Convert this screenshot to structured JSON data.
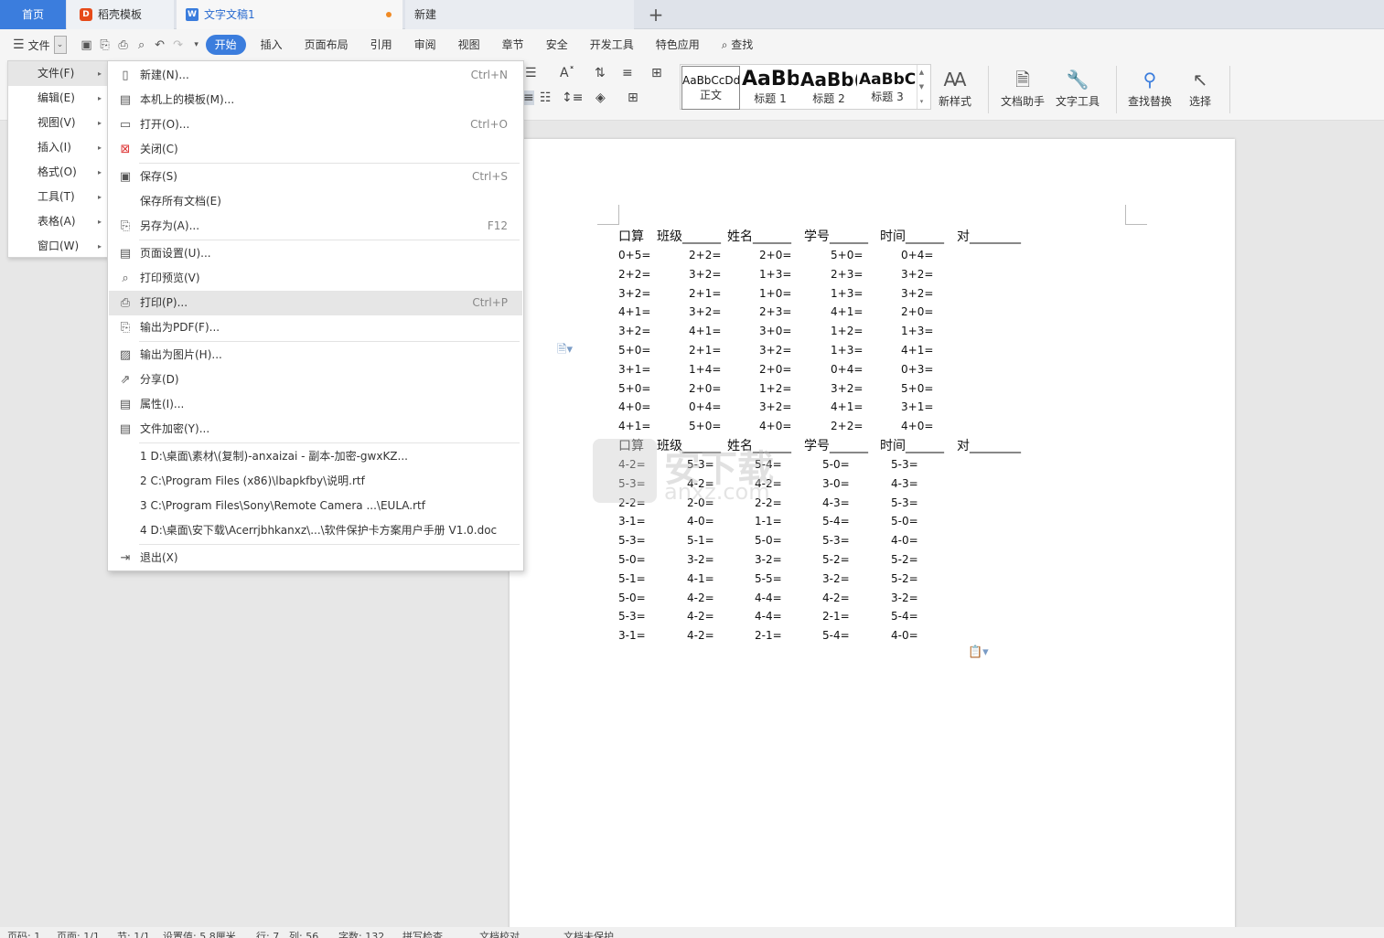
{
  "tabs": {
    "home": "首页",
    "template": "稻壳模板",
    "doc": "文字文稿1",
    "new": "新建",
    "plus": "+"
  },
  "menubar": {
    "file": "文件",
    "items": [
      "开始",
      "插入",
      "页面布局",
      "引用",
      "审阅",
      "视图",
      "章节",
      "安全",
      "开发工具",
      "特色应用"
    ],
    "search": "查找"
  },
  "ribbon": {
    "styles": [
      {
        "sample": "AaBbCcDd",
        "name": "正文"
      },
      {
        "sample": "AaBb",
        "name": "标题 1"
      },
      {
        "sample": "AaBb(",
        "name": "标题 2"
      },
      {
        "sample": "AaBbC(",
        "name": "标题 3"
      }
    ],
    "new_style": "新样式",
    "doc_helper": "文档助手",
    "text_tools": "文字工具",
    "find_replace": "查找替换",
    "select": "选择"
  },
  "side_menu": [
    "文件(F)",
    "编辑(E)",
    "视图(V)",
    "插入(I)",
    "格式(O)",
    "工具(T)",
    "表格(A)",
    "窗口(W)"
  ],
  "file_menu": {
    "new": {
      "label": "新建(N)...",
      "shortcut": "Ctrl+N"
    },
    "local_templates": {
      "label": "本机上的模板(M)..."
    },
    "open": {
      "label": "打开(O)...",
      "shortcut": "Ctrl+O"
    },
    "close": {
      "label": "关闭(C)"
    },
    "save": {
      "label": "保存(S)",
      "shortcut": "Ctrl+S"
    },
    "save_all": {
      "label": "保存所有文档(E)"
    },
    "save_as": {
      "label": "另存为(A)...",
      "shortcut": "F12"
    },
    "page_setup": {
      "label": "页面设置(U)..."
    },
    "print_preview": {
      "label": "打印预览(V)"
    },
    "print": {
      "label": "打印(P)...",
      "shortcut": "Ctrl+P"
    },
    "export_pdf": {
      "label": "输出为PDF(F)..."
    },
    "export_image": {
      "label": "输出为图片(H)..."
    },
    "share": {
      "label": "分享(D)"
    },
    "properties": {
      "label": "属性(I)..."
    },
    "encrypt": {
      "label": "文件加密(Y)..."
    },
    "recent": [
      "1 D:\\桌面\\素材\\(复制)-anxaizai - 副本-加密-gwxKZ...",
      "2 C:\\Program Files (x86)\\lbapkfby\\说明.rtf",
      "3 C:\\Program Files\\Sony\\Remote Camera ...\\EULA.rtf",
      "4 D:\\桌面\\安下载\\Acerrjbhkanxz\\...\\软件保护卡方案用户手册 V1.0.doc"
    ],
    "exit": {
      "label": "退出(X)"
    }
  },
  "document": {
    "headings": [
      "口算",
      "班级______",
      "姓名______",
      "学号______",
      "时间______",
      "对________"
    ],
    "block1": [
      [
        "0+5=",
        "2+2=",
        "2+0=",
        "5+0=",
        "0+4="
      ],
      [
        "2+2=",
        "3+2=",
        "1+3=",
        "2+3=",
        "3+2="
      ],
      [
        "3+2=",
        "2+1=",
        "1+0=",
        "1+3=",
        "3+2="
      ],
      [
        "4+1=",
        "3+2=",
        "2+3=",
        "4+1=",
        "2+0="
      ],
      [
        "3+2=",
        "4+1=",
        "3+0=",
        "1+2=",
        "1+3="
      ],
      [
        "5+0=",
        "2+1=",
        "3+2=",
        "1+3=",
        "4+1="
      ],
      [
        "3+1=",
        "1+4=",
        "2+0=",
        "0+4=",
        "0+3="
      ],
      [
        "5+0=",
        "2+0=",
        "1+2=",
        "3+2=",
        "5+0="
      ],
      [
        "4+0=",
        "0+4=",
        "3+2=",
        "4+1=",
        "3+1="
      ],
      [
        "4+1=",
        "5+0=",
        "4+0=",
        "2+2=",
        "4+0="
      ]
    ],
    "block2": [
      [
        "4-2=",
        "5-3=",
        "5-4=",
        "5-0=",
        "5-3="
      ],
      [
        "5-3=",
        "4-2=",
        "4-2=",
        "3-0=",
        "4-3="
      ],
      [
        "2-2=",
        "2-0=",
        "2-2=",
        "4-3=",
        "5-3="
      ],
      [
        "3-1=",
        "4-0=",
        "1-1=",
        "5-4=",
        "5-0="
      ],
      [
        "5-3=",
        "5-1=",
        "5-0=",
        "5-3=",
        "4-0="
      ],
      [
        "5-0=",
        "3-2=",
        "3-2=",
        "5-2=",
        "5-2="
      ],
      [
        "5-1=",
        "4-1=",
        "5-5=",
        "3-2=",
        "5-2="
      ],
      [
        "5-0=",
        "4-2=",
        "4-4=",
        "4-2=",
        "3-2="
      ],
      [
        "5-3=",
        "4-2=",
        "4-4=",
        "2-1=",
        "5-4="
      ],
      [
        "3-1=",
        "4-2=",
        "2-1=",
        "5-4=",
        "4-0="
      ]
    ]
  },
  "watermark": {
    "text": "安下载",
    "sub": "anxz.com"
  },
  "status": [
    "页码: 1",
    "页面: 1/1",
    "节: 1/1",
    "设置值: 5.8厘米",
    "行: 7",
    "列: 56",
    "字数: 132",
    "拼写检查",
    "文档校对",
    "文档未保护"
  ]
}
